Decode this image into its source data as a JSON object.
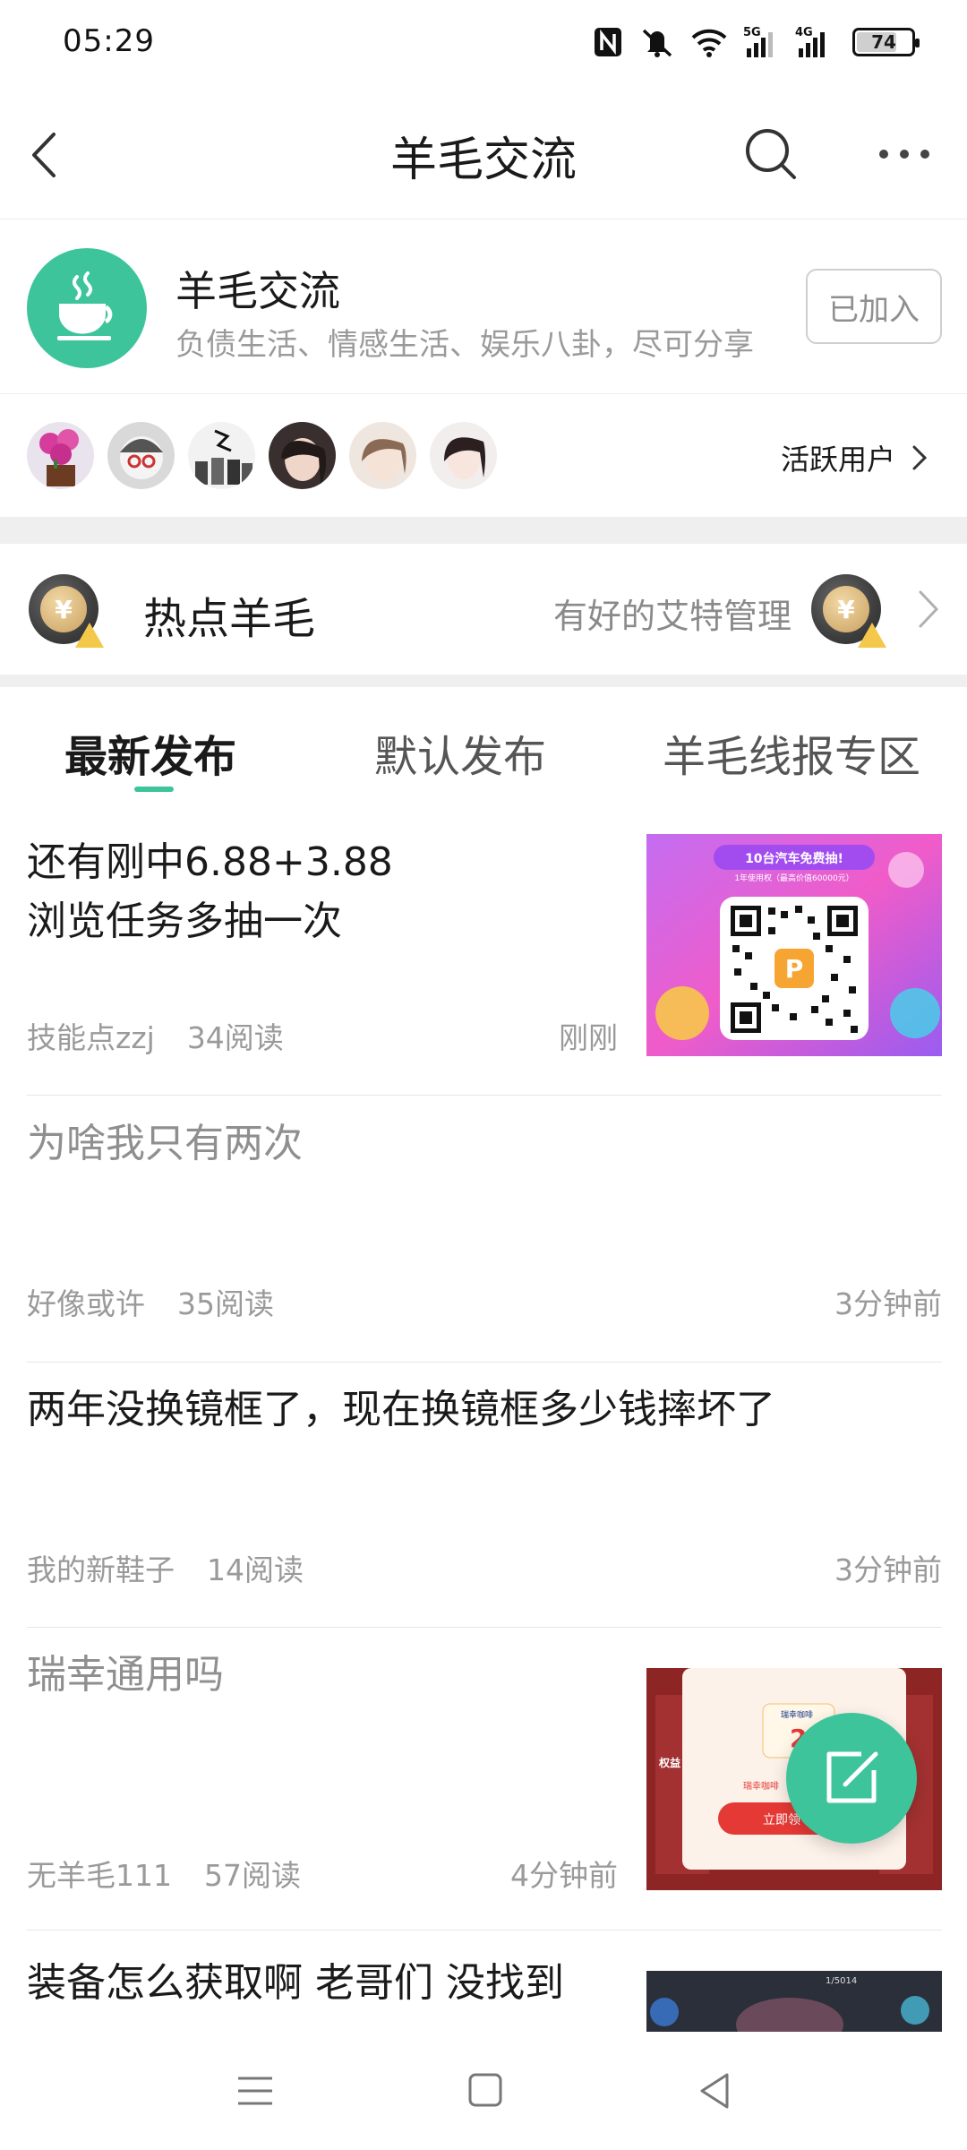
{
  "status_bar": {
    "time": "05:29",
    "icons": [
      "nfc-icon",
      "mute-icon",
      "wifi-icon",
      "signal-5g-icon",
      "signal-4g-icon"
    ],
    "network_5g": "5G",
    "network_4g": "4G",
    "battery": "74"
  },
  "nav": {
    "title": "羊毛交流",
    "back_icon": "back-arrow-icon",
    "search_icon": "search-icon",
    "more_icon": "more-icon"
  },
  "group": {
    "name": "羊毛交流",
    "description": "负债生活、情感生活、娱乐八卦，尽可分享",
    "join_label": "已加入",
    "avatar_icon": "tea-cup-icon"
  },
  "active_users": {
    "label": "活跃用户",
    "count": 6
  },
  "hot": {
    "title": "热点羊毛",
    "admin_text": "有好的艾特管理"
  },
  "tabs": [
    {
      "label": "最新发布",
      "active": true
    },
    {
      "label": "默认发布",
      "active": false
    },
    {
      "label": "羊毛线报专区",
      "active": false
    }
  ],
  "posts": [
    {
      "title_line1": "还有刚中6.88+3.88",
      "title_line2": "浏览任务多抽一次",
      "author": "技能点zzj",
      "reads": "34阅读",
      "time": "刚刚",
      "has_image": true
    },
    {
      "title_line1": "为啥我只有两次",
      "author": "好像或许",
      "reads": "35阅读",
      "time": "3分钟前",
      "has_image": false
    },
    {
      "title_line1": "两年没换镜框了，现在换镜框多少钱摔坏了",
      "author": "我的新鞋子",
      "reads": "14阅读",
      "time": "3分钟前",
      "has_image": false
    },
    {
      "title_line1": "瑞幸通用吗",
      "author": "无羊毛111",
      "reads": "57阅读",
      "time": "4分钟前",
      "has_image": true
    },
    {
      "title_line1": "装备怎么获取啊 老哥们 没找到",
      "has_image": true
    }
  ],
  "thumb_text": {
    "promo_title": "10台汽车免费抽!",
    "promo_sub": "1年使用权（最高价值60000元）",
    "luckin_brand": "瑞幸咖啡",
    "luckin_button": "立即领",
    "luckin_left": "权益",
    "game_counter": "1/5014"
  },
  "colors": {
    "accent": "#3ec49b",
    "text_primary": "#1a1a1a",
    "text_secondary": "#9a9a9a",
    "divider": "#efefef"
  },
  "fab_icon": "edit-icon",
  "system_nav": [
    "menu-icon",
    "home-square-icon",
    "back-triangle-icon"
  ]
}
